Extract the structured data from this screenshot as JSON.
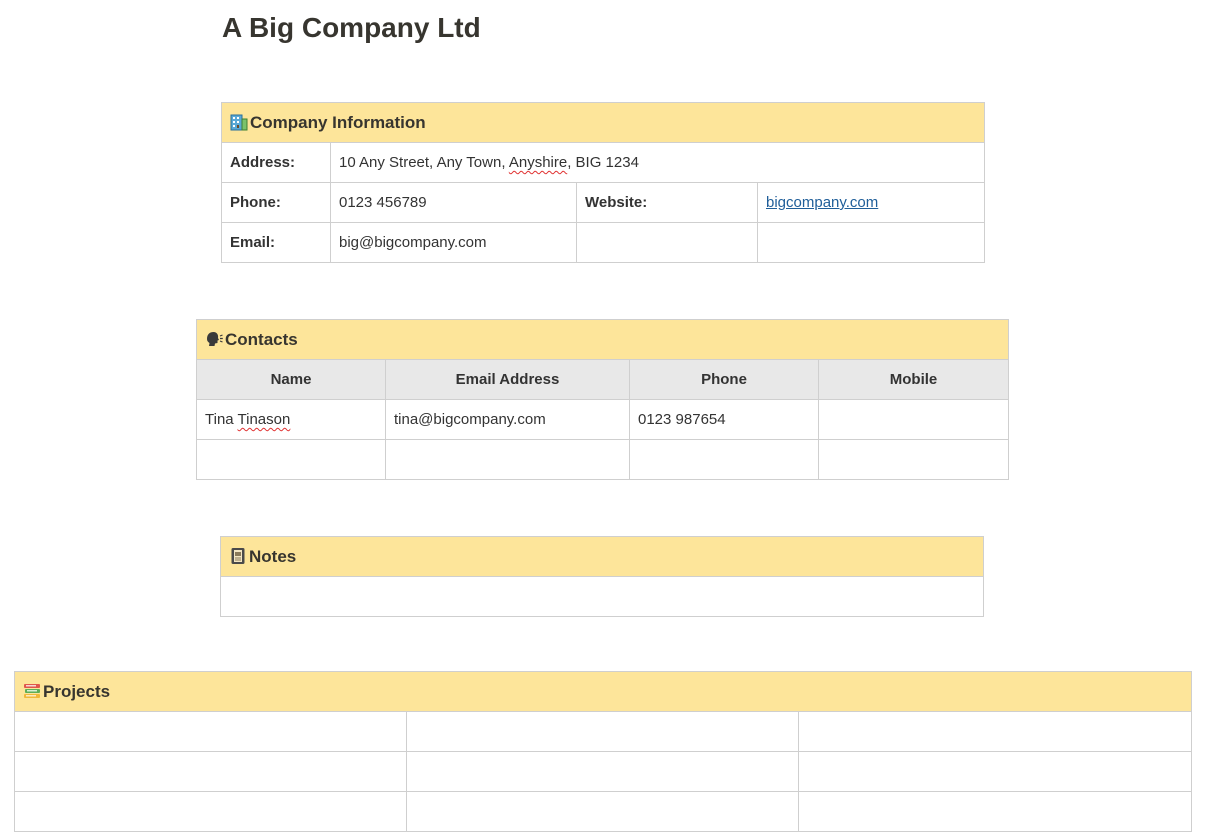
{
  "page": {
    "title": "A Big Company Ltd"
  },
  "company": {
    "heading": "Company Information",
    "icon": "office-building-icon",
    "address_label": "Address:",
    "address_pre": "10 Any Street, Any Town, ",
    "address_flagged": "Anyshire",
    "address_post": ", BIG 1234",
    "phone_label": "Phone:",
    "phone_value": "0123 456789",
    "website_label": "Website:",
    "website_value": "bigcompany.com",
    "email_label": "Email:",
    "email_value": "big@bigcompany.com"
  },
  "contacts": {
    "heading": "Contacts",
    "icon": "speaking-head-icon",
    "columns": [
      "Name",
      "Email Address",
      "Phone",
      "Mobile"
    ],
    "rows": [
      {
        "name_first": "Tina ",
        "name_flagged": "Tinason",
        "email": "tina@bigcompany.com",
        "phone": "0123 987654",
        "mobile": ""
      },
      {
        "name_first": "",
        "name_flagged": "",
        "email": "",
        "phone": "",
        "mobile": ""
      }
    ]
  },
  "notes": {
    "heading": "Notes",
    "icon": "notebook-icon",
    "body": ""
  },
  "projects": {
    "heading": "Projects",
    "icon": "books-icon"
  },
  "colors": {
    "section_header_bg": "#fde59a",
    "column_header_bg": "#e8e8e8",
    "link": "#1f5e99",
    "spellcheck_underline": "#e03030"
  }
}
